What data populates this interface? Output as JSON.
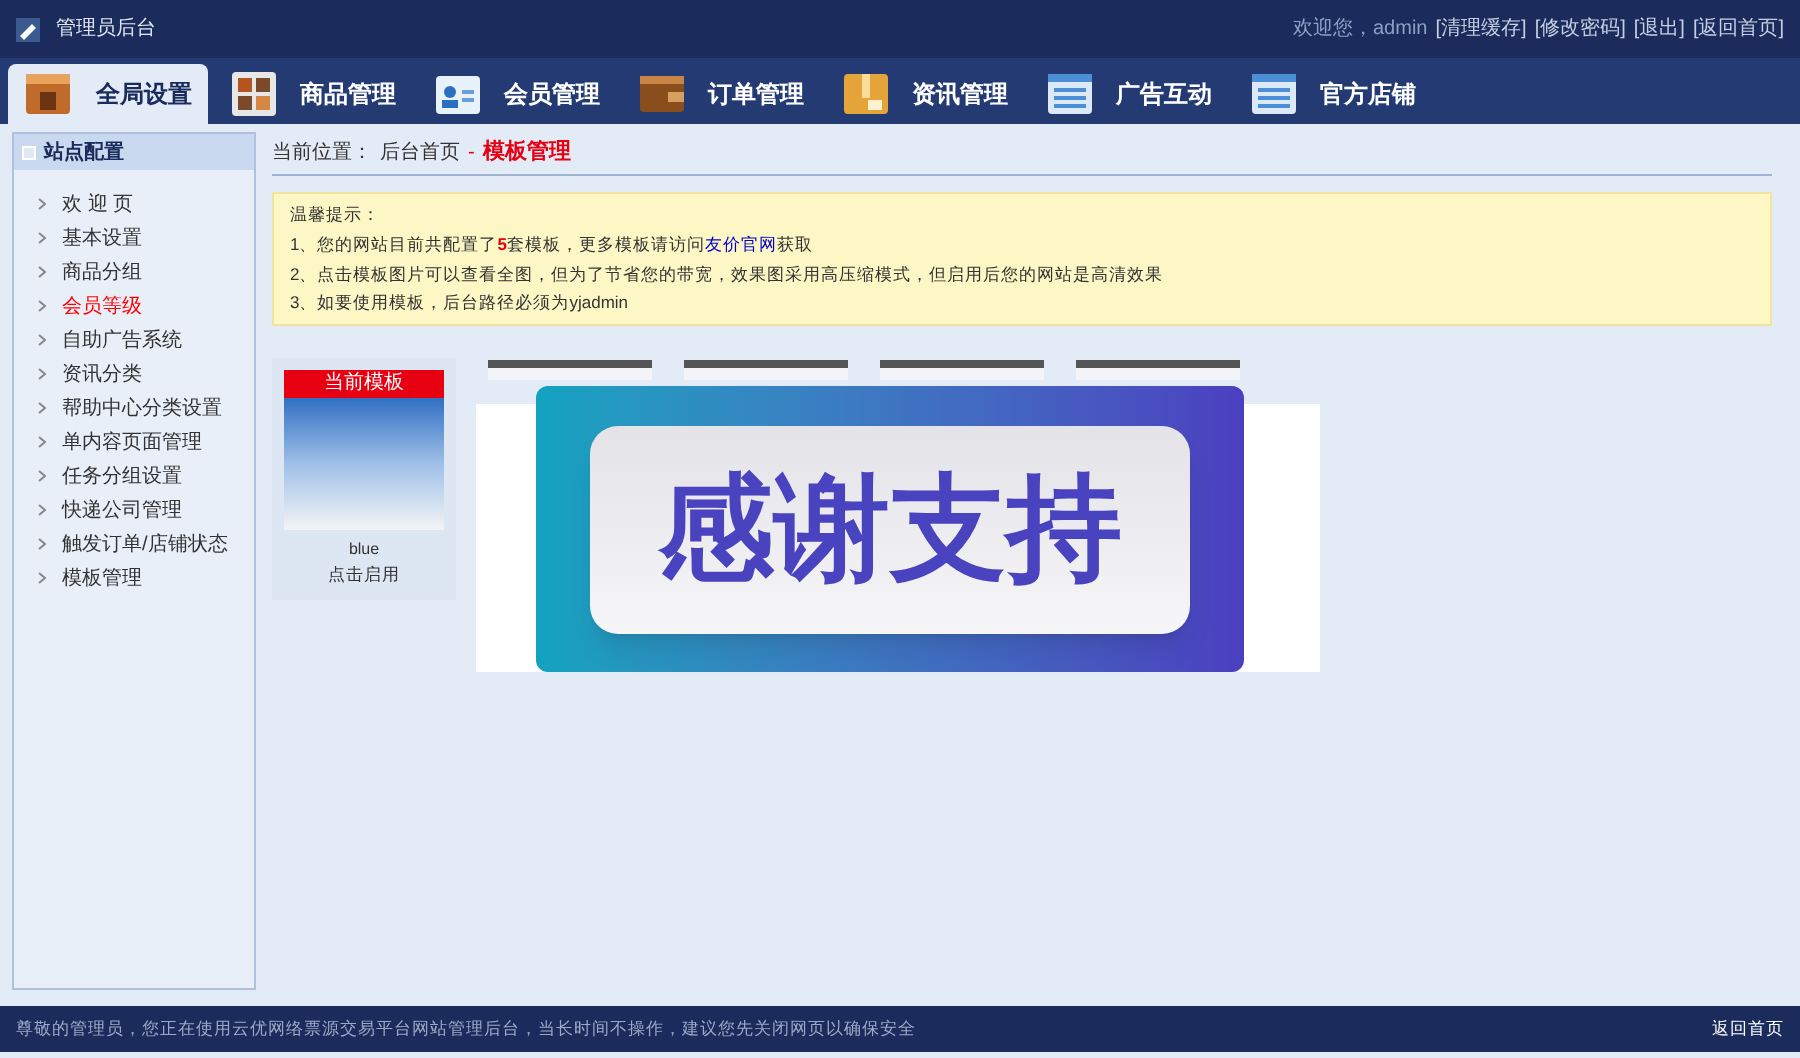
{
  "header": {
    "title": "管理员后台",
    "welcome": "欢迎您，admin",
    "links": [
      "[清理缓存]",
      "[修改密码]",
      "[退出]",
      "[返回首页]"
    ]
  },
  "nav": [
    {
      "label": "全局设置",
      "kind": "box",
      "selected": true
    },
    {
      "label": "商品管理",
      "kind": "grid",
      "selected": false
    },
    {
      "label": "会员管理",
      "kind": "card",
      "selected": false
    },
    {
      "label": "订单管理",
      "kind": "wallet",
      "selected": false
    },
    {
      "label": "资讯管理",
      "kind": "package",
      "selected": false
    },
    {
      "label": "广告互动",
      "kind": "list",
      "selected": false
    },
    {
      "label": "官方店铺",
      "kind": "list",
      "selected": false
    }
  ],
  "sidebar": {
    "title": "站点配置",
    "items": [
      {
        "label": "欢 迎 页",
        "selected": false
      },
      {
        "label": "基本设置",
        "selected": false
      },
      {
        "label": "商品分组",
        "selected": false
      },
      {
        "label": "会员等级",
        "selected": true
      },
      {
        "label": "自助广告系统",
        "selected": false
      },
      {
        "label": "资讯分类",
        "selected": false
      },
      {
        "label": "帮助中心分类设置",
        "selected": false
      },
      {
        "label": "单内容页面管理",
        "selected": false
      },
      {
        "label": "任务分组设置",
        "selected": false
      },
      {
        "label": "快递公司管理",
        "selected": false
      },
      {
        "label": "触发订单/店铺状态",
        "selected": false
      },
      {
        "label": "模板管理",
        "selected": false
      }
    ]
  },
  "breadcrumb": {
    "label": "当前位置：",
    "trail": "后台首页",
    "separator": "-",
    "current": "模板管理"
  },
  "notice": {
    "title": "温馨提示：",
    "lines": [
      "1、您的网站目前共配置了**5**套模板，更多模板请访问",
      "2、点击模板图片可以查看全图，但为了节省您的带宽，效果图采用高压缩模式，但启用后您的网站是高清效果",
      "3、如要使用模板，后台路径必须为yjadmin"
    ],
    "link": "友价官网",
    "link_after": "获取"
  },
  "templates": [
    {
      "current": true,
      "badge": "当前模板",
      "name": "blue",
      "action": "点击启用"
    },
    {
      "current": false
    },
    {
      "current": false
    },
    {
      "current": false
    },
    {
      "current": false
    }
  ],
  "overlay": {
    "text": "感谢支持"
  },
  "footer": {
    "message": "尊敬的管理员，您正在使用云优网络票源交易平台网站管理后台，当长时间不操作，建议您先关闭网页以确保安全",
    "link": "返回首页"
  }
}
